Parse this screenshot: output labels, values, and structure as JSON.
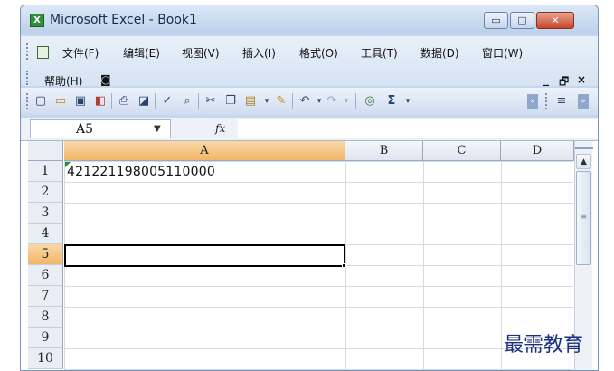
{
  "window": {
    "title": "Microsoft Excel - Book1",
    "app_icon": "excel-icon",
    "controls": {
      "minimize": "▭",
      "maximize": "□",
      "close": "✕"
    }
  },
  "menu": {
    "items": [
      "文件(F)",
      "编辑(E)",
      "视图(V)",
      "插入(I)",
      "格式(O)",
      "工具(T)",
      "数据(D)",
      "窗口(W)"
    ],
    "row2": [
      "帮助(H)"
    ],
    "doc_min": "_",
    "doc_restore": "🗗",
    "doc_close": "×"
  },
  "toolbar": {
    "icons": [
      "new",
      "open",
      "save",
      "permission",
      "print",
      "print-preview",
      "spelling",
      "research",
      "cut",
      "copy",
      "paste",
      "format-painter",
      "undo",
      "redo",
      "hyperlink",
      "autosum"
    ],
    "sigma": "Σ"
  },
  "formula_bar": {
    "name_box": "A5",
    "fx": "fx",
    "value": ""
  },
  "grid": {
    "columns": [
      "A",
      "B",
      "C",
      "D"
    ],
    "rows": [
      "1",
      "2",
      "3",
      "4",
      "5",
      "6",
      "7",
      "8",
      "9",
      "10"
    ],
    "active_column": "A",
    "active_row": "5",
    "cells": {
      "A1": "421221198005110000"
    }
  },
  "watermark": "最需教育"
}
